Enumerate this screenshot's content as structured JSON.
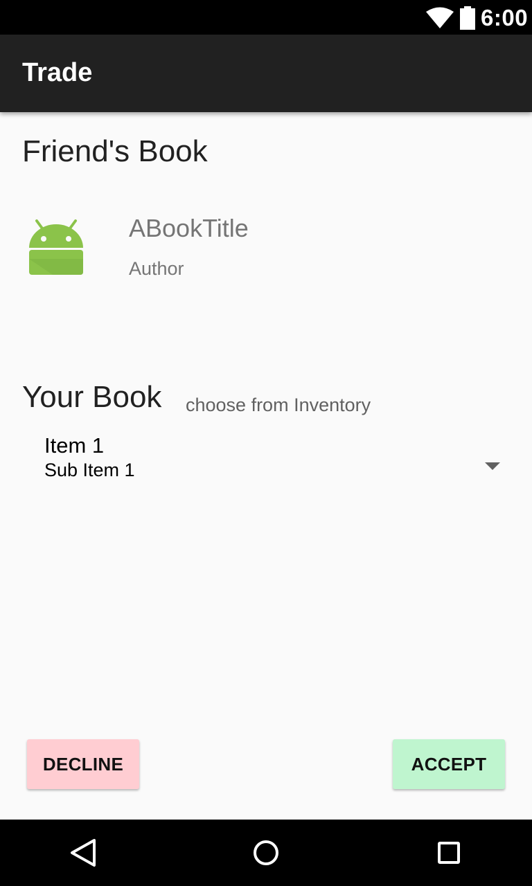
{
  "status_bar": {
    "time": "6:00",
    "icons": [
      "wifi-icon",
      "battery-icon"
    ]
  },
  "app_bar": {
    "title": "Trade"
  },
  "friends_book": {
    "heading": "Friend's Book",
    "icon": "android-icon",
    "title": "ABookTitle",
    "author": "Author"
  },
  "your_book": {
    "heading": "Your Book",
    "hint": "choose from Inventory",
    "spinner": {
      "item": "Item 1",
      "sub_item": "Sub Item 1",
      "icon": "dropdown-arrow-icon"
    }
  },
  "actions": {
    "decline_label": "DECLINE",
    "accept_label": "ACCEPT",
    "decline_color": "#ffcdd2",
    "accept_color": "#bff5cf"
  },
  "nav_bar": {
    "icons": [
      "back-icon",
      "home-icon",
      "recents-icon"
    ]
  },
  "colors": {
    "status_bar": "#000000",
    "app_bar": "#212121",
    "background": "#fafafa",
    "android_green": "#8bc34a"
  }
}
